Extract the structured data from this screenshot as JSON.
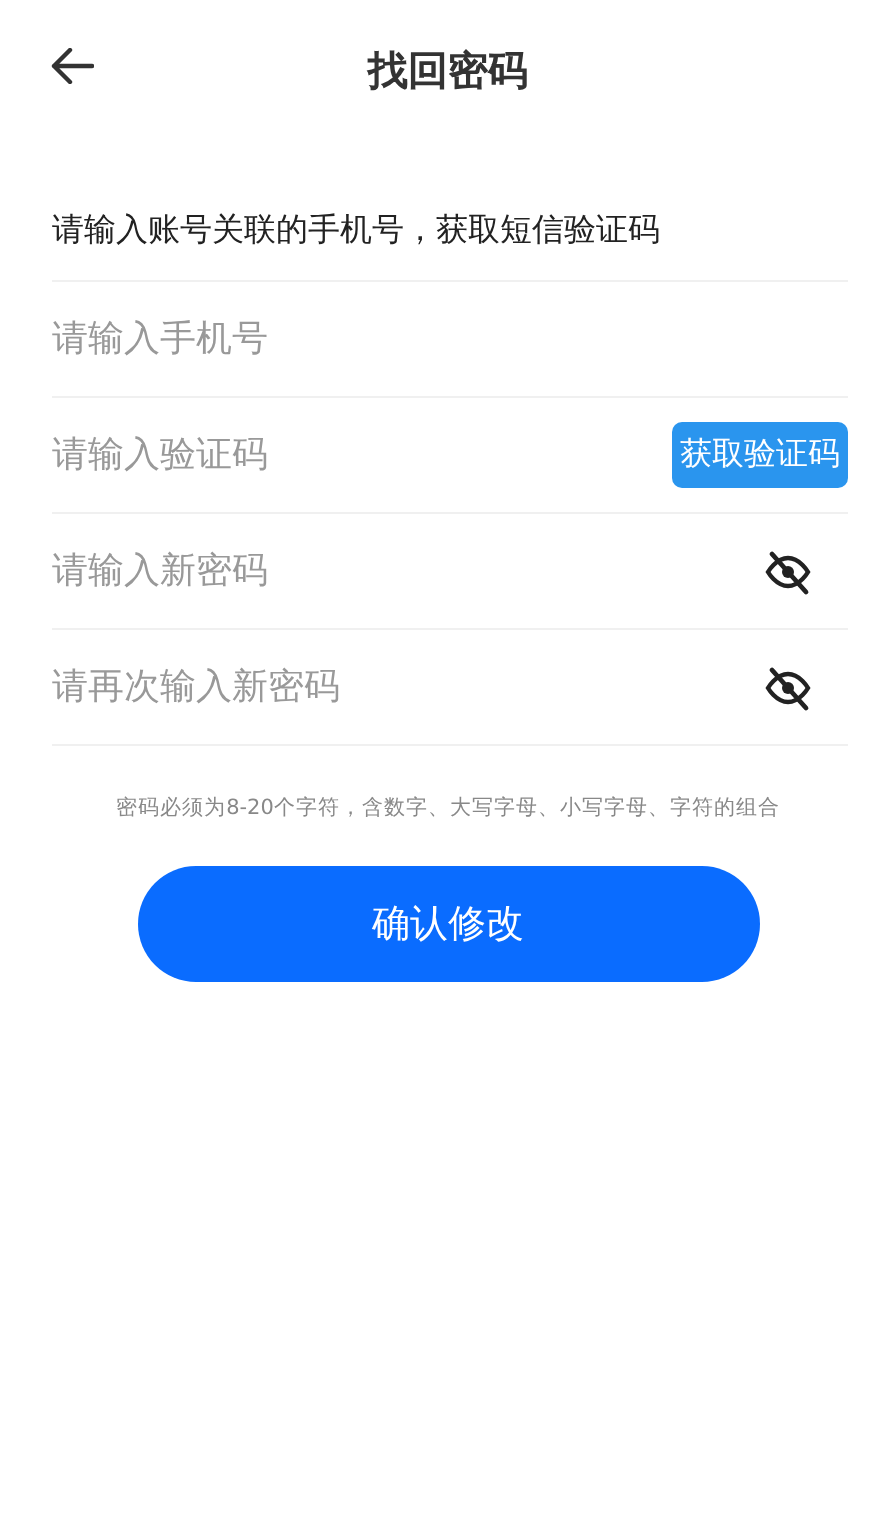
{
  "header": {
    "title": "找回密码"
  },
  "instruction": "请输入账号关联的手机号，获取短信验证码",
  "fields": [
    {
      "kind": "text",
      "placeholder": "请输入手机号"
    },
    {
      "kind": "code",
      "placeholder": "请输入验证码",
      "button": "获取验证码"
    },
    {
      "kind": "password",
      "placeholder": "请输入新密码",
      "revealed": false
    },
    {
      "kind": "password",
      "placeholder": "请再次输入新密码",
      "revealed": false
    }
  ],
  "hint": "密码必须为8-20个字符，含数字、大写字母、小写字母、字符的组合",
  "submit": "确认修改"
}
